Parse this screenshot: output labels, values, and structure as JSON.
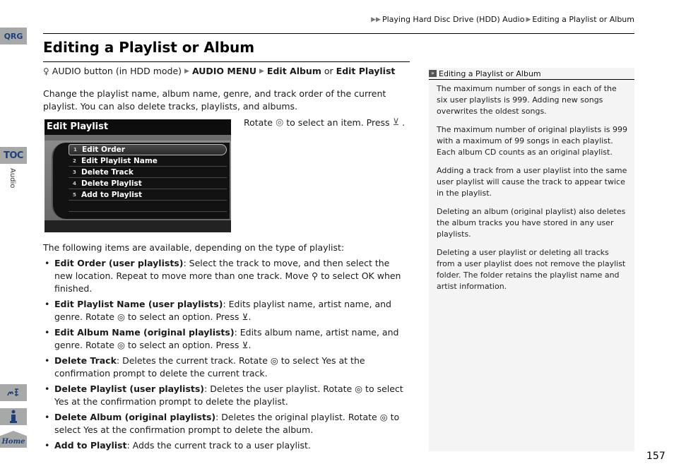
{
  "side_tabs": {
    "qrg": "QRG",
    "toc": "TOC",
    "section": "Audio",
    "voice_icon": "voice-command-icon",
    "info_icon": "info-icon",
    "home": "Home"
  },
  "breadcrumb": {
    "items": [
      "Playing Hard Disc Drive (HDD) Audio",
      "Editing a Playlist or Album"
    ]
  },
  "title": "Editing a Playlist or Album",
  "nav_path": {
    "start": "AUDIO button (in HDD mode)",
    "step1": "AUDIO MENU",
    "step2a": "Edit Album",
    "or": "or",
    "step2b": "Edit Playlist"
  },
  "intro": "Change the playlist name, album name, genre, and track order of the current playlist. You can also delete tracks, playlists, and albums.",
  "screen": {
    "title": "Edit Playlist",
    "items": [
      {
        "num": "1",
        "label": "Edit Order"
      },
      {
        "num": "2",
        "label": "Edit Playlist Name"
      },
      {
        "num": "3",
        "label": "Delete Track"
      },
      {
        "num": "4",
        "label": "Delete Playlist"
      },
      {
        "num": "5",
        "label": "Add to Playlist"
      }
    ]
  },
  "rotate_instruction": {
    "rotate": "Rotate",
    "mid": "to select an item. Press",
    "end": "."
  },
  "list_intro": "The following items are available, depending on the type of playlist:",
  "bullets": [
    {
      "term": "Edit Order (user playlists)",
      "text": ": Select the track to move, and then select the new location. Repeat to move more than one track. Move ⚲ to select OK when finished."
    },
    {
      "term": "Edit Playlist Name (user playlists)",
      "text": ": Edits playlist name, artist name, and genre. Rotate ◎ to select an option. Press ⊻."
    },
    {
      "term": "Edit Album Name (original playlists)",
      "text": ": Edits album name, artist name, and genre. Rotate ◎ to select an option. Press ⊻."
    },
    {
      "term": "Delete Track",
      "text": ": Deletes the current track. Rotate ◎ to select Yes at the confirmation prompt to delete the current track."
    },
    {
      "term": "Delete Playlist (user playlists)",
      "text": ": Deletes the user playlist. Rotate ◎ to select Yes at the confirmation prompt to delete the playlist."
    },
    {
      "term": "Delete Album (original playlists)",
      "text": ": Deletes the original playlist. Rotate ◎ to select Yes at the confirmation prompt to delete the album."
    },
    {
      "term": "Add to Playlist",
      "text": ": Adds the current track to a user playlist."
    }
  ],
  "sidenote": {
    "title": "Editing a Playlist or Album",
    "paragraphs": [
      "The maximum number of songs in each of the six user playlists is 999. Adding new songs overwrites the oldest songs.",
      "The maximum number of original playlists is 999 with a maximum of 99 songs in each playlist. Each album CD counts as an original playlist.",
      "Adding a track from a user playlist into the same user playlist will cause the track to appear twice in the playlist.",
      "Deleting an album (original playlist) also deletes the album tracks you have stored in any user playlists.",
      "Deleting a user playlist or deleting all tracks from a user playlist does not remove the playlist folder. The folder retains the playlist name and artist information."
    ]
  },
  "page_number": "157"
}
